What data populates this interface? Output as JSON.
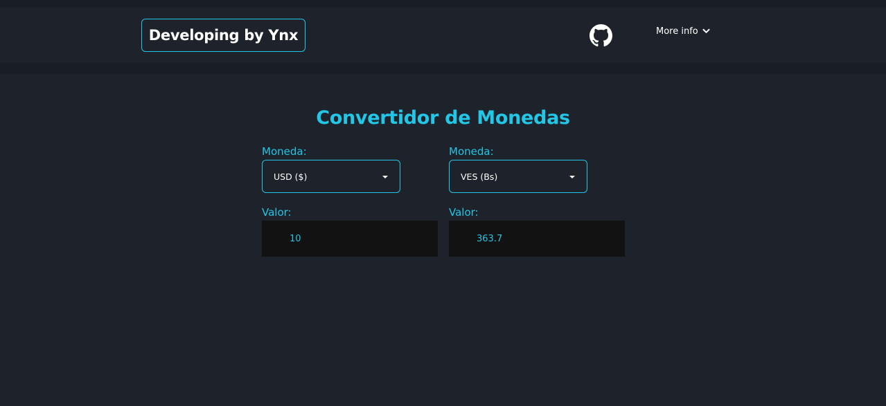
{
  "header": {
    "brand": "Developing by Ynx",
    "github_icon": "github-icon",
    "more_info_label": "More info",
    "more_info_icon": "chevron-down-icon"
  },
  "converter": {
    "title": "Convertidor de Monedas",
    "from": {
      "currency_label": "Moneda:",
      "currency_value": "USD ($)",
      "value_label": "Valor:",
      "value": "10"
    },
    "to": {
      "currency_label": "Moneda:",
      "currency_value": "VES (Bs)",
      "value_label": "Valor:",
      "value": "363.7"
    }
  },
  "colors": {
    "accent": "#22c6e6",
    "background": "#1e232b",
    "input_background": "#121212"
  }
}
